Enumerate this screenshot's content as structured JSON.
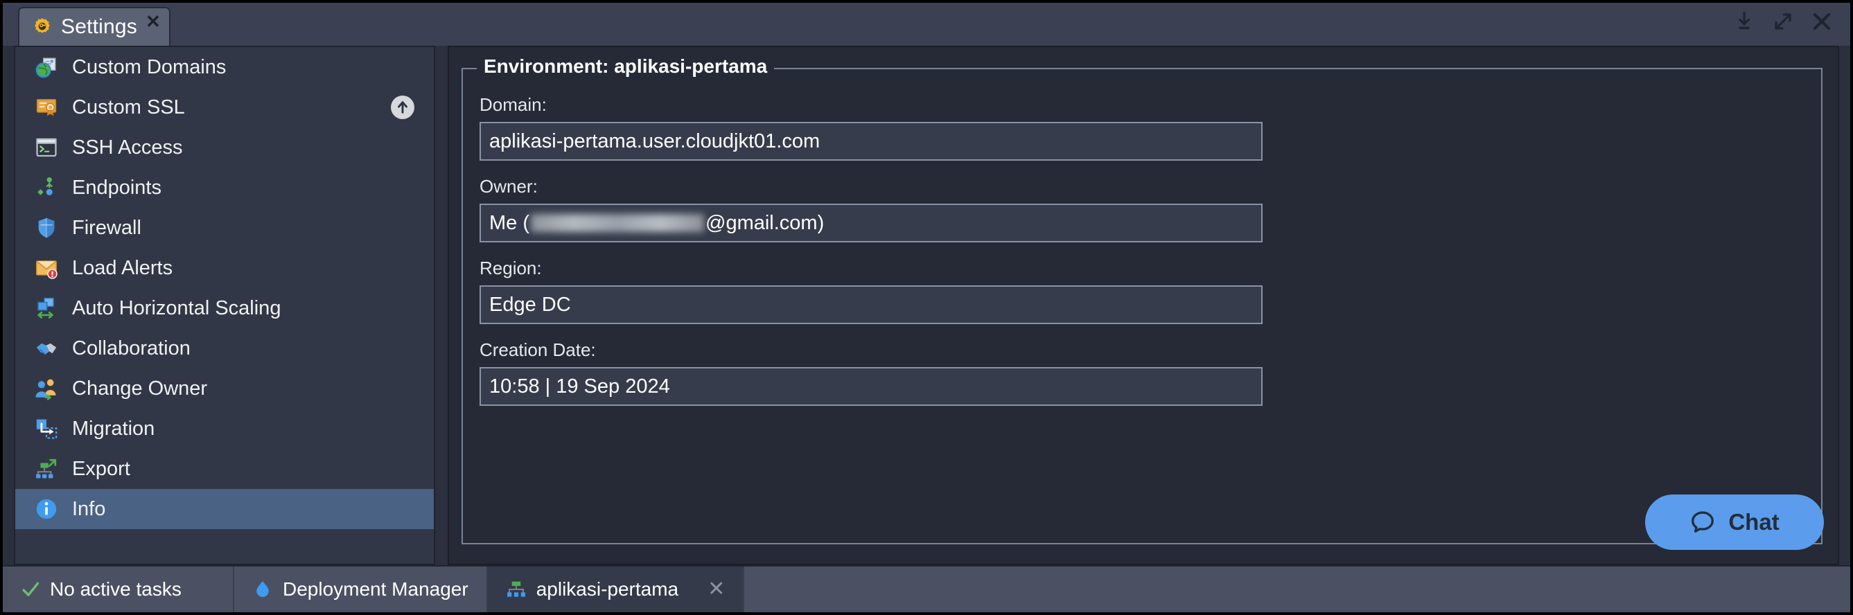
{
  "window": {
    "tab_title": "Settings",
    "tab_icon": "gear-icon",
    "close_label": "✕",
    "controls": [
      {
        "name": "minimize-icon",
        "label": "minimize"
      },
      {
        "name": "maximize-icon",
        "label": "maximize"
      },
      {
        "name": "close-icon",
        "label": "close"
      }
    ]
  },
  "sidebar": {
    "items": [
      {
        "label": "Custom Domains",
        "icon": "globe-document-icon",
        "selected": false,
        "badge": false
      },
      {
        "label": "Custom SSL",
        "icon": "certificate-icon",
        "selected": false,
        "badge": true
      },
      {
        "label": "SSH Access",
        "icon": "terminal-icon",
        "selected": false,
        "badge": false
      },
      {
        "label": "Endpoints",
        "icon": "endpoints-nodes-icon",
        "selected": false,
        "badge": false
      },
      {
        "label": "Firewall",
        "icon": "shield-icon",
        "selected": false,
        "badge": false
      },
      {
        "label": "Load Alerts",
        "icon": "envelope-alert-icon",
        "selected": false,
        "badge": false
      },
      {
        "label": "Auto Horizontal Scaling",
        "icon": "horizontal-scaling-icon",
        "selected": false,
        "badge": false
      },
      {
        "label": "Collaboration",
        "icon": "handshake-icon",
        "selected": false,
        "badge": false
      },
      {
        "label": "Change Owner",
        "icon": "users-transfer-icon",
        "selected": false,
        "badge": false
      },
      {
        "label": "Migration",
        "icon": "migration-arrow-icon",
        "selected": false,
        "badge": false
      },
      {
        "label": "Export",
        "icon": "export-tree-icon",
        "selected": false,
        "badge": false
      },
      {
        "label": "Info",
        "icon": "info-circle-icon",
        "selected": true,
        "badge": false
      }
    ],
    "badge_icon": "upgrade-arrow-icon"
  },
  "main": {
    "legend": "Environment: aplikasi-pertama",
    "fields": [
      {
        "label": "Domain:",
        "value": "aplikasi-pertama.user.cloudjkt01.com",
        "redacted": false
      },
      {
        "label": "Owner:",
        "value_prefix": "Me (",
        "value_suffix": "@gmail.com)",
        "redacted": true
      },
      {
        "label": "Region:",
        "value": "Edge DC",
        "redacted": false
      },
      {
        "label": "Creation Date:",
        "value": "10:58 | 19 Sep 2024",
        "redacted": false
      }
    ]
  },
  "chat": {
    "label": "Chat",
    "icon": "chat-bubble-icon",
    "color": "#5b9ced"
  },
  "statusbar": {
    "tasks_label": "No active tasks",
    "tasks_icon": "checkmark-icon",
    "items": [
      {
        "label": "Deployment Manager",
        "icon": "deployment-drop-icon",
        "active": false,
        "closable": false
      },
      {
        "label": "aplikasi-pertama",
        "icon": "environment-tree-icon",
        "active": true,
        "closable": true
      }
    ],
    "close_label": "✕"
  },
  "colors": {
    "accent_selected": "#4a6283",
    "chat_blue": "#5b9ced",
    "titlebar": "#3b4152",
    "sidebar_bg": "#323747",
    "panel_bg": "#252a36",
    "statusbar": "#4b5162"
  }
}
